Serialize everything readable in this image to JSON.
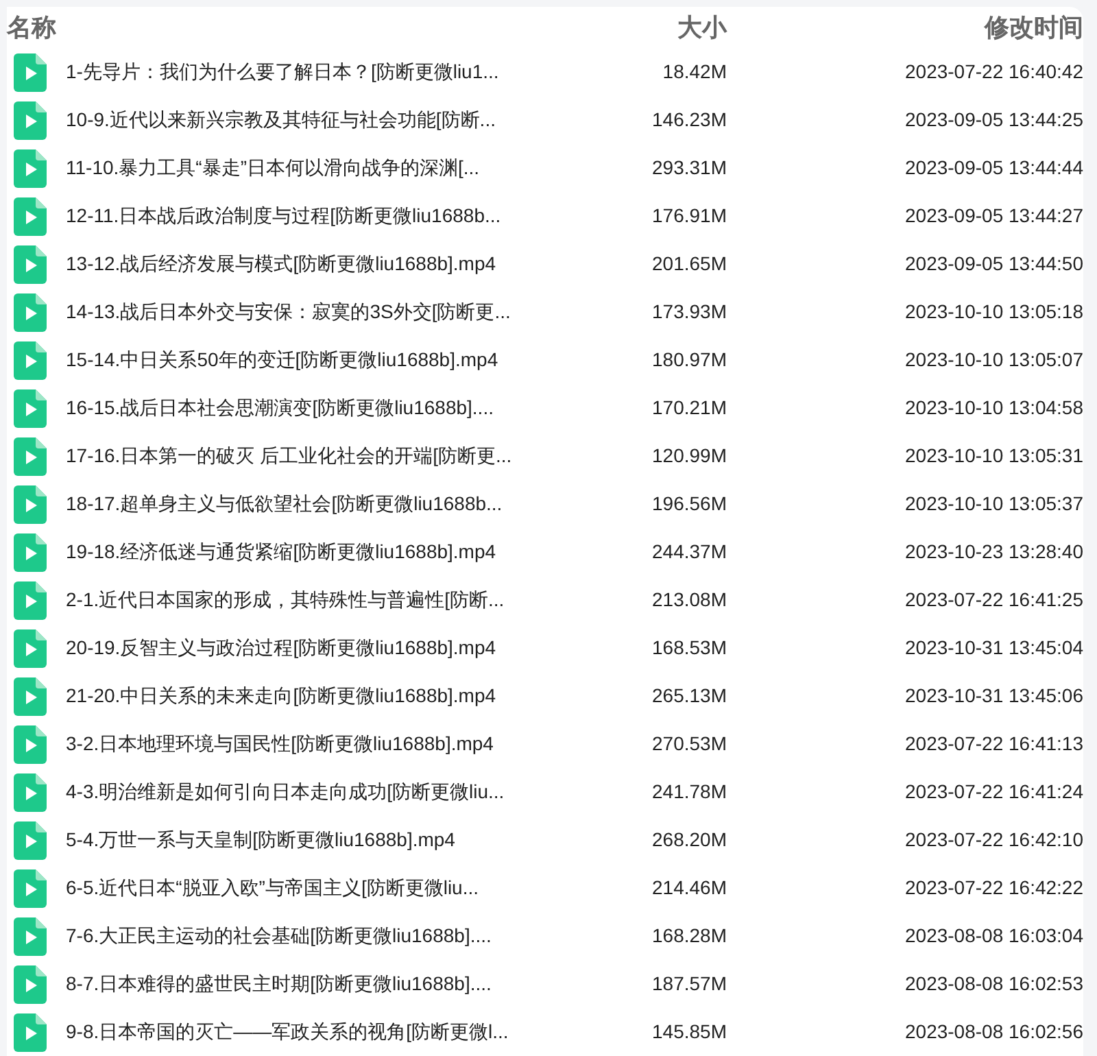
{
  "table": {
    "columns": [
      "名称",
      "大小",
      "修改时间"
    ],
    "rows": [
      {
        "name": "1-先导片：我们为什么要了解日本？[防断更微liu1...",
        "size": "18.42M",
        "modified": "2023-07-22 16:40:42"
      },
      {
        "name": "10-9.近代以来新兴宗教及其特征与社会功能[防断...",
        "size": "146.23M",
        "modified": "2023-09-05 13:44:25"
      },
      {
        "name": "11-10.暴力工具“暴走”日本何以滑向战争的深渊[...",
        "size": "293.31M",
        "modified": "2023-09-05 13:44:44"
      },
      {
        "name": "12-11.日本战后政治制度与过程[防断更微liu1688b...",
        "size": "176.91M",
        "modified": "2023-09-05 13:44:27"
      },
      {
        "name": "13-12.战后经济发展与模式[防断更微liu1688b].mp4",
        "size": "201.65M",
        "modified": "2023-09-05 13:44:50"
      },
      {
        "name": "14-13.战后日本外交与安保：寂寞的3S外交[防断更...",
        "size": "173.93M",
        "modified": "2023-10-10 13:05:18"
      },
      {
        "name": "15-14.中日关系50年的变迁[防断更微liu1688b].mp4",
        "size": "180.97M",
        "modified": "2023-10-10 13:05:07"
      },
      {
        "name": "16-15.战后日本社会思潮演变[防断更微liu1688b]....",
        "size": "170.21M",
        "modified": "2023-10-10 13:04:58"
      },
      {
        "name": "17-16.日本第一的破灭 后工业化社会的开端[防断更...",
        "size": "120.99M",
        "modified": "2023-10-10 13:05:31"
      },
      {
        "name": "18-17.超单身主义与低欲望社会[防断更微liu1688b...",
        "size": "196.56M",
        "modified": "2023-10-10 13:05:37"
      },
      {
        "name": "19-18.经济低迷与通货紧缩[防断更微liu1688b].mp4",
        "size": "244.37M",
        "modified": "2023-10-23 13:28:40"
      },
      {
        "name": "2-1.近代日本国家的形成，其特殊性与普遍性[防断...",
        "size": "213.08M",
        "modified": "2023-07-22 16:41:25"
      },
      {
        "name": "20-19.反智主义与政治过程[防断更微liu1688b].mp4",
        "size": "168.53M",
        "modified": "2023-10-31 13:45:04"
      },
      {
        "name": "21-20.中日关系的未来走向[防断更微liu1688b].mp4",
        "size": "265.13M",
        "modified": "2023-10-31 13:45:06"
      },
      {
        "name": "3-2.日本地理环境与国民性[防断更微liu1688b].mp4",
        "size": "270.53M",
        "modified": "2023-07-22 16:41:13"
      },
      {
        "name": "4-3.明治维新是如何引向日本走向成功[防断更微liu...",
        "size": "241.78M",
        "modified": "2023-07-22 16:41:24"
      },
      {
        "name": "5-4.万世一系与天皇制[防断更微liu1688b].mp4",
        "size": "268.20M",
        "modified": "2023-07-22 16:42:10"
      },
      {
        "name": "6-5.近代日本“脱亚入欧”与帝国主义[防断更微liu...",
        "size": "214.46M",
        "modified": "2023-07-22 16:42:22"
      },
      {
        "name": "7-6.大正民主运动的社会基础[防断更微liu1688b]....",
        "size": "168.28M",
        "modified": "2023-08-08 16:03:04"
      },
      {
        "name": "8-7.日本难得的盛世民主时期[防断更微liu1688b]....",
        "size": "187.57M",
        "modified": "2023-08-08 16:02:53"
      },
      {
        "name": "9-8.日本帝国的灭亡——军政关系的视角[防断更微l...",
        "size": "145.85M",
        "modified": "2023-08-08 16:02:56"
      }
    ]
  }
}
